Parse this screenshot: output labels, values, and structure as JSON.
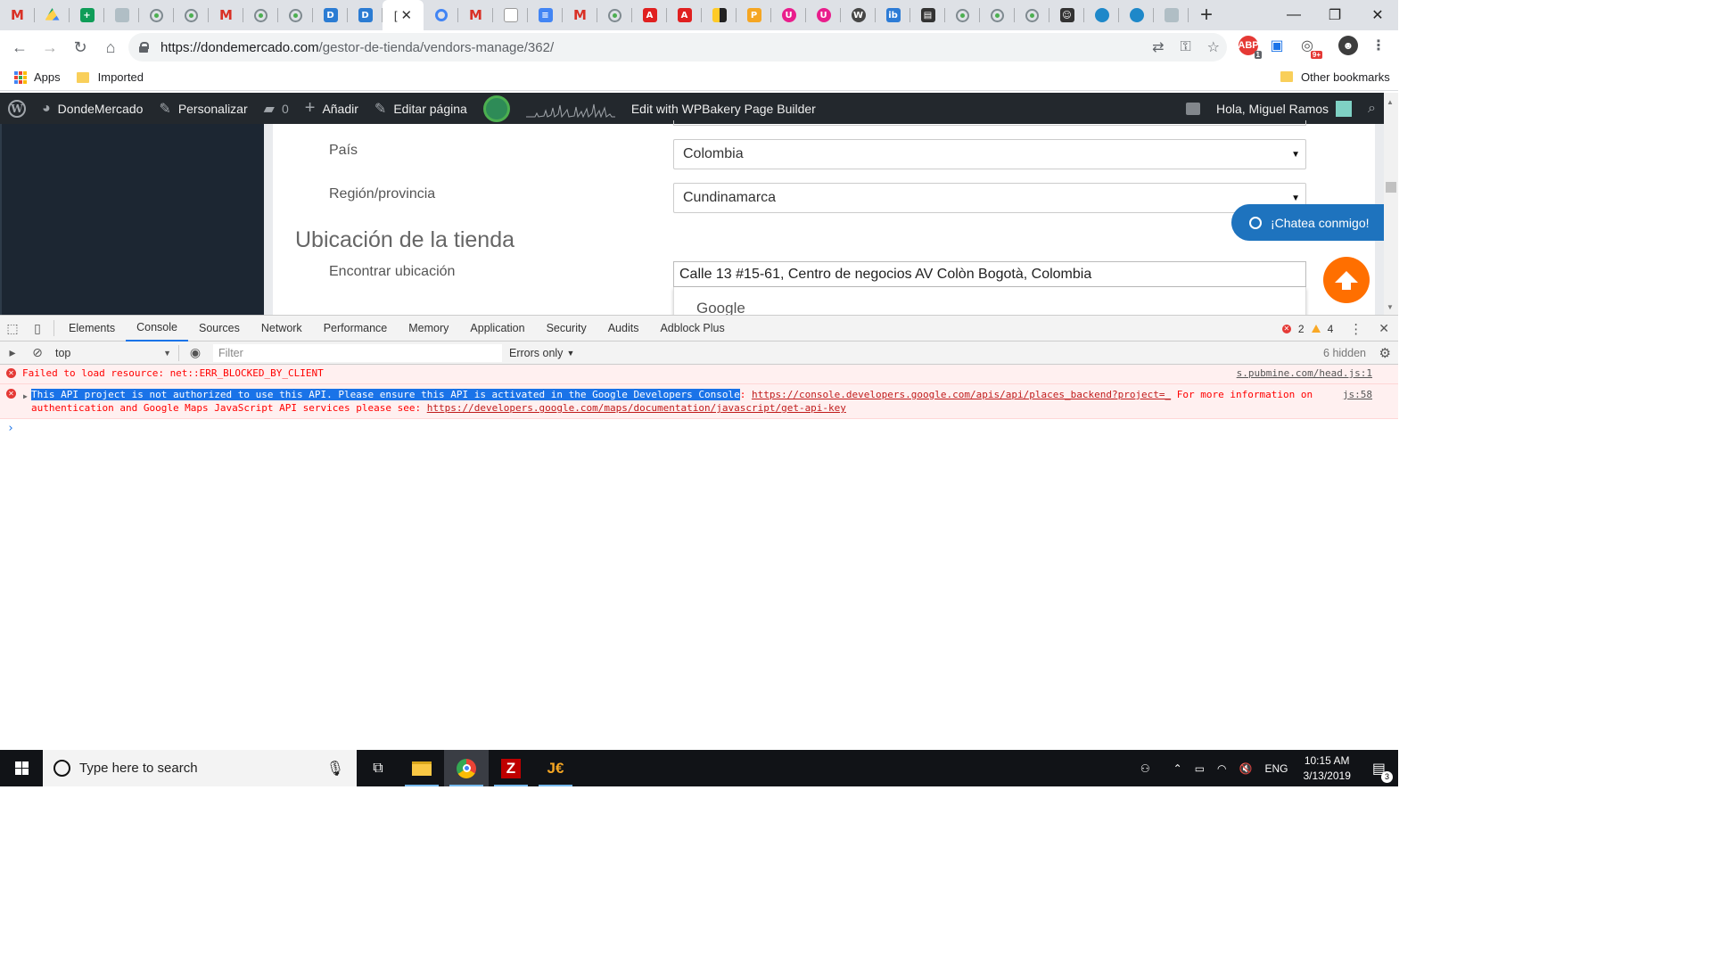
{
  "browser": {
    "tabs": [
      {
        "icon": "gmail-icon",
        "kind": "gm",
        "glyph": "M"
      },
      {
        "icon": "drive-icon",
        "kind": "drive",
        "glyph": ""
      },
      {
        "icon": "sheets-icon",
        "kind": "sheets",
        "glyph": "+"
      },
      {
        "icon": "envelope-icon",
        "kind": "grey",
        "glyph": ""
      },
      {
        "icon": "dondemercado-icon",
        "kind": "dm",
        "glyph": ""
      },
      {
        "icon": "dondemercado-icon",
        "kind": "dm",
        "glyph": ""
      },
      {
        "icon": "gmail-icon",
        "kind": "gm",
        "glyph": "M"
      },
      {
        "icon": "dondemercado-icon",
        "kind": "dm",
        "glyph": ""
      },
      {
        "icon": "dondemercado-icon",
        "kind": "dm",
        "glyph": ""
      },
      {
        "icon": "word-icon",
        "kind": "word",
        "glyph": "D"
      },
      {
        "icon": "word-icon",
        "kind": "word",
        "glyph": "D"
      }
    ],
    "active_tab": {
      "icon": "page-icon",
      "glyph": "["
    },
    "tabs_after": [
      {
        "icon": "chrome-icon",
        "kind": "chrome-o",
        "glyph": ""
      },
      {
        "icon": "gmail-icon",
        "kind": "gm",
        "glyph": "M"
      },
      {
        "icon": "document-icon",
        "kind": "doc",
        "glyph": ""
      },
      {
        "icon": "docs-icon",
        "kind": "docs",
        "glyph": "≡"
      },
      {
        "icon": "gmail-icon",
        "kind": "gm",
        "glyph": "M"
      },
      {
        "icon": "dondemercado-icon",
        "kind": "dm",
        "glyph": ""
      },
      {
        "icon": "pdf-icon",
        "kind": "pdf",
        "glyph": "A"
      },
      {
        "icon": "pdf-icon",
        "kind": "pdf",
        "glyph": "A"
      },
      {
        "icon": "stripes-icon",
        "kind": "yellowbar",
        "glyph": ""
      },
      {
        "icon": "pma-icon",
        "kind": "pma",
        "glyph": "P"
      },
      {
        "icon": "pink-circle-icon",
        "kind": "pink",
        "glyph": "U"
      },
      {
        "icon": "pink-circle-icon",
        "kind": "pink",
        "glyph": "U"
      },
      {
        "icon": "wordpress-icon",
        "kind": "wp",
        "glyph": "W"
      },
      {
        "icon": "ibb-icon",
        "kind": "ib",
        "glyph": "ib"
      },
      {
        "icon": "film-icon",
        "kind": "dark",
        "glyph": "▤"
      },
      {
        "icon": "dondemercado-icon",
        "kind": "dm",
        "glyph": ""
      },
      {
        "icon": "dondemercado-icon",
        "kind": "dm",
        "glyph": ""
      },
      {
        "icon": "dondemercado-icon",
        "kind": "dm",
        "glyph": ""
      },
      {
        "icon": "photo-icon",
        "kind": "dark",
        "glyph": "☺"
      },
      {
        "icon": "globe-icon",
        "kind": "teal",
        "glyph": ""
      },
      {
        "icon": "globe-icon",
        "kind": "teal",
        "glyph": ""
      },
      {
        "icon": "screen-icon",
        "kind": "grey",
        "glyph": ""
      }
    ],
    "url_host": "https://dondemercado.com",
    "url_path": "/gestor-de-tienda/vendors-manage/362/",
    "bookmarks": {
      "apps": "Apps",
      "imported": "Imported",
      "other": "Other bookmarks"
    },
    "ext_badge_abp": "1",
    "ext_badge_notif": "9+"
  },
  "wpbar": {
    "site": "DondeMercado",
    "customize": "Personalizar",
    "comments": "0",
    "add_new": "Añadir",
    "edit_page": "Editar página",
    "wpbakery": "Edit with WPBakery Page Builder",
    "greeting": "Hola, Miguel Ramos"
  },
  "form": {
    "country_label": "País",
    "country_value": "Colombia",
    "region_label": "Región/provincia",
    "region_value": "Cundinamarca",
    "section_title": "Ubicación de la tienda",
    "find_label": "Encontrar ubicación",
    "address_value": "Calle 13 #15-61, Centro de negocios AV Colòn  Bogotà, Colombia",
    "autocomplete_brand": "Google"
  },
  "widgets": {
    "chat_label": "¡Chatea conmigo!"
  },
  "devtools": {
    "tabs": [
      "Elements",
      "Console",
      "Sources",
      "Network",
      "Performance",
      "Memory",
      "Application",
      "Security",
      "Audits",
      "Adblock Plus"
    ],
    "active_tab": "Console",
    "error_count": "2",
    "warning_count": "4",
    "context": "top",
    "filter_placeholder": "Filter",
    "levels": "Errors only",
    "hidden": "6 hidden",
    "messages": [
      {
        "text": "Failed to load resource: net::ERR_BLOCKED_BY_CLIENT",
        "source": "s.pubmine.com/head.js:1"
      },
      {
        "selected": "This API project is not authorized to use this API. Please ensure this API is activated in the Google Developers Console",
        "colon": ":",
        "link1": "https://console.developers.google.com/apis/api/places_backend?project=_",
        "middle": "For more information on authentication and Google Maps JavaScript API services please see:",
        "link2": "https://developers.google.com/maps/documentation/javascript/get-api-key",
        "source": "js:58"
      }
    ]
  },
  "taskbar": {
    "search_placeholder": "Type here to search",
    "lang": "ENG",
    "time": "10:15 AM",
    "date": "3/13/2019",
    "notifications": "3"
  },
  "colors": {
    "wp_admin_bar": "#23282d",
    "accent_blue": "#1e73be",
    "scroll_top_orange": "#ff6f00",
    "console_error": "#ff0000"
  }
}
